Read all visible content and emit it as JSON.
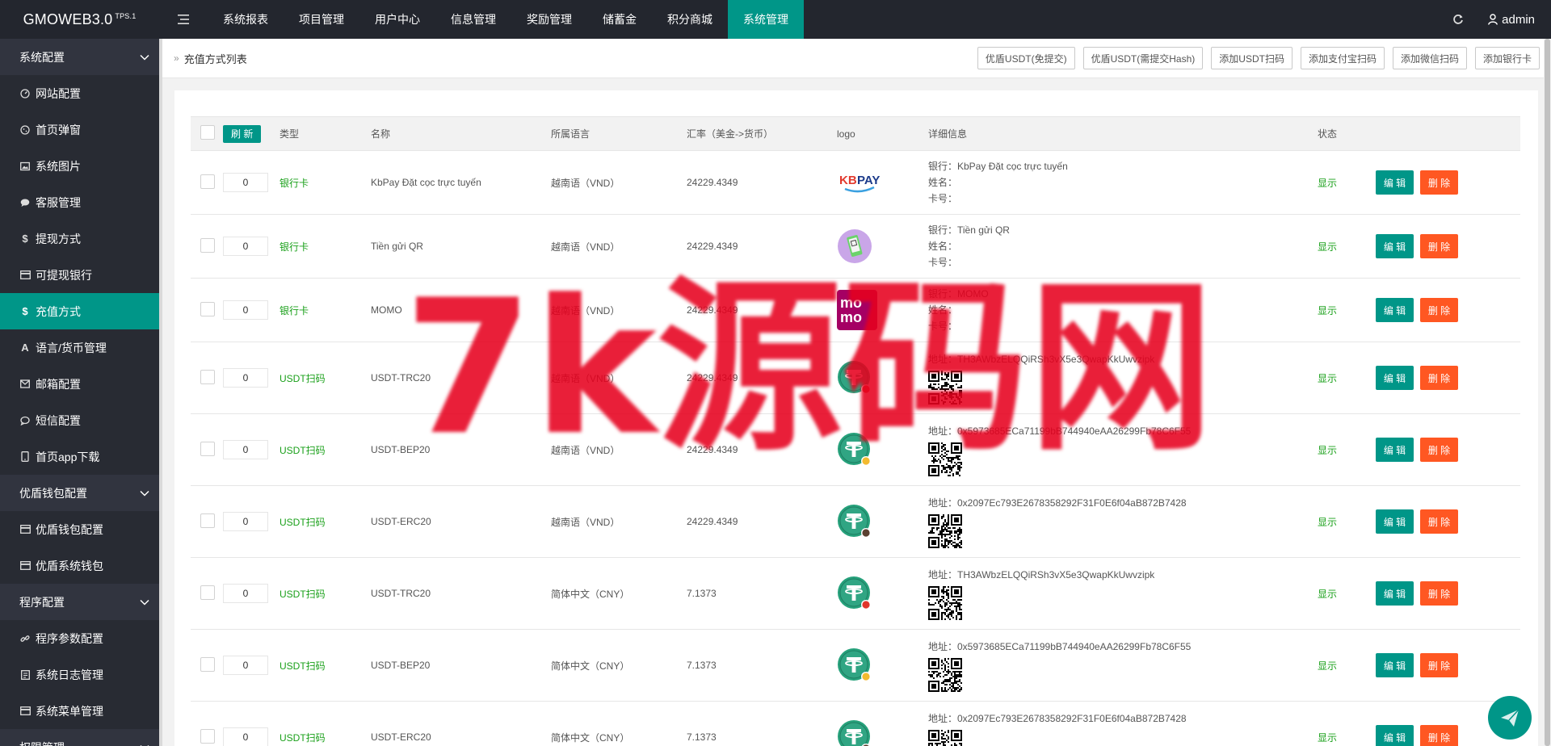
{
  "app": {
    "logo": "GMOWEB3.0",
    "version": "TPS.1",
    "user": "admin"
  },
  "nav": [
    {
      "label": "系统报表"
    },
    {
      "label": "项目管理"
    },
    {
      "label": "用户中心"
    },
    {
      "label": "信息管理"
    },
    {
      "label": "奖励管理"
    },
    {
      "label": "储蓄金"
    },
    {
      "label": "积分商城"
    },
    {
      "label": "系统管理",
      "active": true
    }
  ],
  "sidebar": {
    "groups": [
      {
        "label": "系统配置",
        "items": [
          {
            "label": "网站配置",
            "icon": "dashboard-icon"
          },
          {
            "label": "首页弹窗",
            "icon": "cookie-icon"
          },
          {
            "label": "系统图片",
            "icon": "image-icon"
          },
          {
            "label": "客服管理",
            "icon": "chat-icon"
          },
          {
            "label": "提现方式",
            "icon": "dollar-icon"
          },
          {
            "label": "可提现银行",
            "icon": "card-icon"
          },
          {
            "label": "充值方式",
            "icon": "dollar-icon",
            "active": true
          },
          {
            "label": "语言/货币管理",
            "icon": "font-icon"
          },
          {
            "label": "邮箱配置",
            "icon": "mail-icon"
          },
          {
            "label": "短信配置",
            "icon": "comment-icon"
          },
          {
            "label": "首页app下载",
            "icon": "mobile-icon"
          }
        ]
      },
      {
        "label": "优盾钱包配置",
        "items": [
          {
            "label": "优盾钱包配置",
            "icon": "card-icon"
          },
          {
            "label": "优盾系统钱包",
            "icon": "card-icon"
          }
        ]
      },
      {
        "label": "程序配置",
        "items": [
          {
            "label": "程序参数配置",
            "icon": "link-icon"
          },
          {
            "label": "系统日志管理",
            "icon": "log-icon"
          },
          {
            "label": "系统菜单管理",
            "icon": "card-icon"
          }
        ]
      },
      {
        "label": "权限管理",
        "items": []
      }
    ]
  },
  "breadcrumb": {
    "title": "充值方式列表"
  },
  "actions": [
    {
      "label": "优盾USDT(免提交)"
    },
    {
      "label": "优盾USDT(需提交Hash)"
    },
    {
      "label": "添加USDT扫码"
    },
    {
      "label": "添加支付宝扫码"
    },
    {
      "label": "添加微信扫码"
    },
    {
      "label": "添加银行卡"
    }
  ],
  "table": {
    "refresh_label": "刷 新",
    "headers": {
      "type": "类型",
      "name": "名称",
      "language": "所属语言",
      "rate": "汇率（美金->货币）",
      "logo": "logo",
      "detail": "详细信息",
      "status": "状态"
    },
    "edit_label": "编 辑",
    "delete_label": "删 除",
    "rows": [
      {
        "sort": "0",
        "type": "银行卡",
        "name": "KbPay Đặt cọc trực tuyến",
        "language": "越南语（VND）",
        "rate": "24229.4349",
        "logo": "kbpay-logo",
        "detail": [
          "银行：KbPay Đặt cọc trực tuyến",
          "姓名：",
          "卡号："
        ],
        "status": "显示"
      },
      {
        "sort": "0",
        "type": "银行卡",
        "name": "Tiền gửi QR",
        "language": "越南语（VND）",
        "rate": "24229.4349",
        "logo": "qr-phone-logo",
        "detail": [
          "银行：Tiền gửi QR",
          "姓名：",
          "卡号："
        ],
        "status": "显示"
      },
      {
        "sort": "0",
        "type": "银行卡",
        "name": "MOMO",
        "language": "越南语（VND）",
        "rate": "24229.4349",
        "logo": "momo-logo",
        "detail": [
          "银行：MOMO",
          "姓名：",
          "卡号："
        ],
        "status": "显示"
      },
      {
        "sort": "0",
        "type": "USDT扫码",
        "name": "USDT-TRC20",
        "language": "越南语（VND）",
        "rate": "24229.4349",
        "logo": "tether-trc-logo",
        "detail": [
          "地址：TH3AWbzELQQiRSh3vX5e3QwapKkUwvzipk"
        ],
        "qr": true,
        "status": "显示"
      },
      {
        "sort": "0",
        "type": "USDT扫码",
        "name": "USDT-BEP20",
        "language": "越南语（VND）",
        "rate": "24229.4349",
        "logo": "tether-bep-logo",
        "detail": [
          "地址：0x5973685ECa71199bB744940eAA26299Fb78C6F55"
        ],
        "qr": true,
        "status": "显示"
      },
      {
        "sort": "0",
        "type": "USDT扫码",
        "name": "USDT-ERC20",
        "language": "越南语（VND）",
        "rate": "24229.4349",
        "logo": "tether-erc-logo",
        "detail": [
          "地址：0x2097Ec793E2678358292F31F0E6f04aB872B7428"
        ],
        "qr": true,
        "status": "显示"
      },
      {
        "sort": "0",
        "type": "USDT扫码",
        "name": "USDT-TRC20",
        "language": "简体中文（CNY）",
        "rate": "7.1373",
        "logo": "tether-trc-logo",
        "detail": [
          "地址：TH3AWbzELQQiRSh3vX5e3QwapKkUwvzipk"
        ],
        "qr": true,
        "status": "显示"
      },
      {
        "sort": "0",
        "type": "USDT扫码",
        "name": "USDT-BEP20",
        "language": "简体中文（CNY）",
        "rate": "7.1373",
        "logo": "tether-bep-logo",
        "detail": [
          "地址：0x5973685ECa71199bB744940eAA26299Fb78C6F55"
        ],
        "qr": true,
        "status": "显示"
      },
      {
        "sort": "0",
        "type": "USDT扫码",
        "name": "USDT-ERC20",
        "language": "简体中文（CNY）",
        "rate": "7.1373",
        "logo": "tether-erc-logo",
        "detail": [
          "地址：0x2097Ec793E2678358292F31F0E6f04aB872B7428"
        ],
        "qr": true,
        "status": "显示"
      }
    ]
  },
  "watermark": "7k源码网",
  "colors": {
    "accent": "#009688",
    "danger": "#ff5722",
    "topbar": "#23262e",
    "sidebar": "#393d49",
    "status_green": "#1aa01a"
  }
}
